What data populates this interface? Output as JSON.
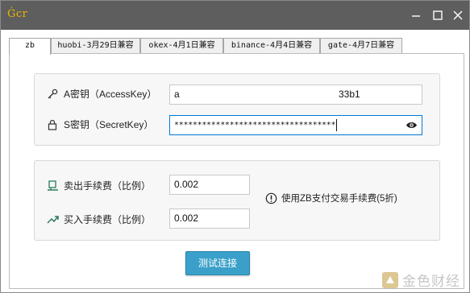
{
  "window": {
    "app_icon_text": "Ġcr",
    "colors": {
      "titlebar": "#5e5e5e",
      "accent": "#0078d7",
      "button": "#3aa0c9"
    }
  },
  "tabs": [
    {
      "label": "zb",
      "active": true
    },
    {
      "label": "huobi-3月29日兼容",
      "active": false
    },
    {
      "label": "okex-4月1日兼容",
      "active": false
    },
    {
      "label": "binance-4月4日兼容",
      "active": false
    },
    {
      "label": "gate-4月7日兼容",
      "active": false
    }
  ],
  "keys": {
    "access_label": "A密钥（AccessKey）",
    "access_value_start": "a",
    "access_value_end": "33b1",
    "secret_label": "S密钥（SecretKey）",
    "secret_value": "***********************************",
    "icons": {
      "access": "key-icon",
      "secret": "lock-icon",
      "reveal": "eye-icon"
    }
  },
  "fees": {
    "sell_label": "卖出手续费（比例）",
    "sell_value": "0.002",
    "buy_label": "买入手续费（比例）",
    "buy_value": "0.002",
    "hint": "使用ZB支付交易手续费(5折)",
    "icons": {
      "sell": "sell-icon",
      "buy": "buy-icon",
      "hint": "info-icon"
    }
  },
  "connect_button": "测试连接",
  "watermark": "金色财经"
}
